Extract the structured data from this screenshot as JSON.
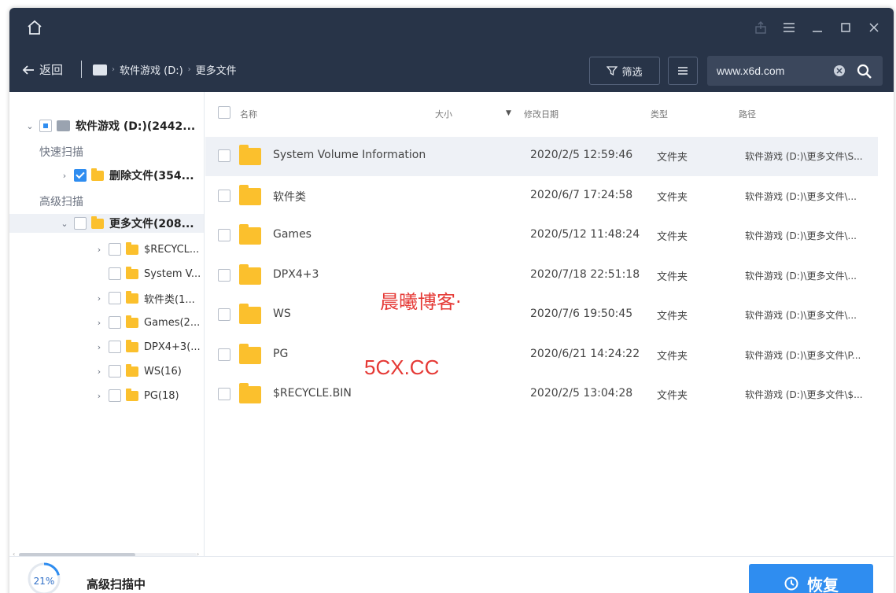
{
  "titlebar": {
    "home_icon": "home-icon",
    "controls": [
      "share-icon",
      "menu-icon",
      "minimize-icon",
      "maximize-icon",
      "close-icon"
    ]
  },
  "navbar": {
    "back_label": "返回",
    "breadcrumb": [
      "软件游戏 (D:)",
      "更多文件"
    ],
    "filter_label": "筛选",
    "search_value": "www.x6d.com"
  },
  "tree": {
    "root_label": "软件游戏 (D:)(2442...",
    "quick_scan_label": "快速扫描",
    "deleted_files_label": "删除文件(354...",
    "advanced_scan_label": "高级扫描",
    "more_files_label": "更多文件(208...",
    "children": [
      {
        "label": "$RECYCL...",
        "expandable": true
      },
      {
        "label": "System V...",
        "expandable": false
      },
      {
        "label": "软件类(1...",
        "expandable": true
      },
      {
        "label": "Games(2...",
        "expandable": true
      },
      {
        "label": "DPX4+3(...",
        "expandable": true
      },
      {
        "label": "WS(16)",
        "expandable": true
      },
      {
        "label": "PG(18)",
        "expandable": true
      }
    ]
  },
  "columns": {
    "name": "名称",
    "size": "大小",
    "date": "修改日期",
    "type": "类型",
    "path": "路径"
  },
  "files": [
    {
      "name": "System Volume Information",
      "date": "2020/2/5 12:59:46",
      "type": "文件夹",
      "path": "软件游戏 (D:)\\更多文件\\S..."
    },
    {
      "name": "软件类",
      "date": "2020/6/7 17:24:58",
      "type": "文件夹",
      "path": "软件游戏 (D:)\\更多文件\\..."
    },
    {
      "name": "Games",
      "date": "2020/5/12 11:48:24",
      "type": "文件夹",
      "path": "软件游戏 (D:)\\更多文件\\..."
    },
    {
      "name": "DPX4+3",
      "date": "2020/7/18 22:51:18",
      "type": "文件夹",
      "path": "软件游戏 (D:)\\更多文件\\..."
    },
    {
      "name": "WS",
      "date": "2020/7/6 19:50:45",
      "type": "文件夹",
      "path": "软件游戏 (D:)\\更多文件\\..."
    },
    {
      "name": "PG",
      "date": "2020/6/21 14:24:22",
      "type": "文件夹",
      "path": "软件游戏 (D:)\\更多文件\\P..."
    },
    {
      "name": "$RECYCLE.BIN",
      "date": "2020/2/5 13:04:28",
      "type": "文件夹",
      "path": "软件游戏 (D:)\\更多文件\\$..."
    }
  ],
  "watermark": {
    "line1": "晨曦博客·",
    "line2": "5CX.CC"
  },
  "footer": {
    "progress": "21%",
    "progress_value": 0.21,
    "status": "高级扫描中",
    "recover_label": "恢复"
  },
  "colors": {
    "header_bg": "#283448",
    "accent": "#2f8df0",
    "folder": "#fbc02d",
    "watermark": "#e53935"
  }
}
